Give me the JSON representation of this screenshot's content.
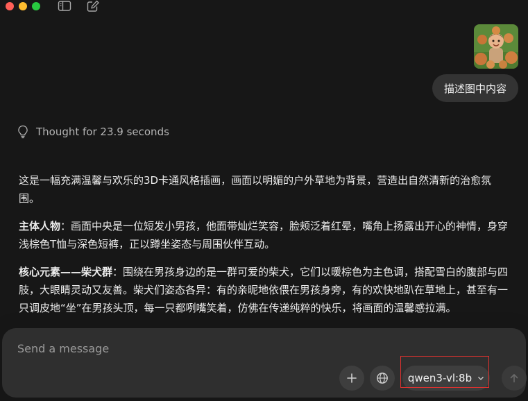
{
  "chat": {
    "user_message": "描述图中内容",
    "thought_label": "Thought for 23.9 seconds",
    "response": {
      "p1": "这是一幅充满温馨与欢乐的3D卡通风格插画，画面以明媚的户外草地为背景，营造出自然清新的治愈氛围。",
      "p2_head": "主体人物",
      "p2_body": "：画面中央是一位短发小男孩，他面带灿烂笑容，脸颊泛着红晕，嘴角上扬露出开心的神情，身穿浅棕色T恤与深色短裤，正以蹲坐姿态与周围伙伴互动。",
      "p3_head": "核心元素——柴犬群",
      "p3_body": "：围绕在男孩身边的是一群可爱的柴犬，它们以暖棕色为主色调，搭配雪白的腹部与四肢，大眼睛灵动又友善。柴犬们姿态各异：有的亲昵地依偎在男孩身旁，有的欢快地趴在草地上，甚至有一只调皮地“坐”在男孩头顶，每一只都咧嘴笑着，仿佛在传递纯粹的快乐，将画面的温馨感拉满。"
    }
  },
  "composer": {
    "placeholder": "Send a message",
    "model": "qwen3-vl:8b"
  },
  "icons": {
    "sidebar": "sidebar-toggle-icon",
    "new_chat": "compose-icon",
    "thought": "lightbulb-icon",
    "plus": "plus-icon",
    "globe": "globe-icon",
    "chevron": "chevron-down-icon",
    "send": "arrow-up-icon"
  },
  "colors": {
    "background": "#171717",
    "bubble": "#333333",
    "composer": "#2f2f2f",
    "highlight": "#e0322f"
  }
}
